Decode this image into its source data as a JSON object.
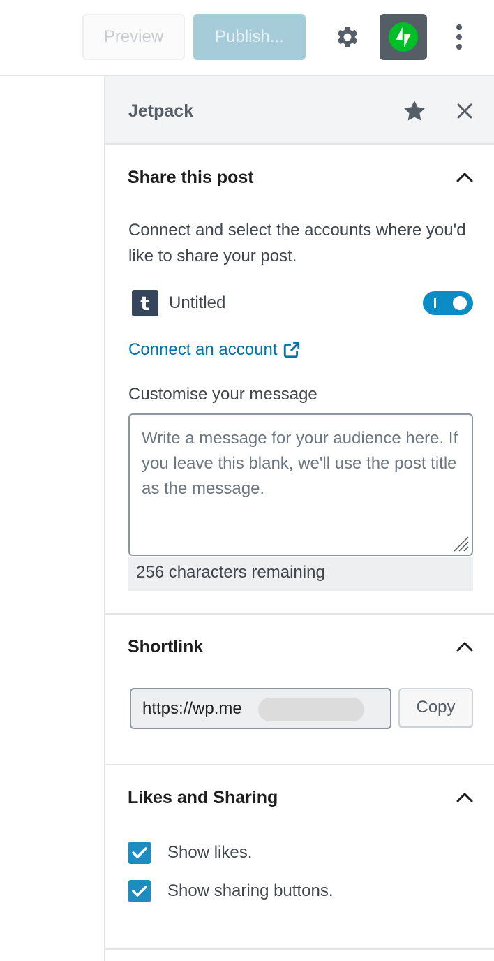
{
  "toolbar": {
    "preview_label": "Preview",
    "publish_label": "Publish...",
    "settings_icon": "gear-icon",
    "jetpack_icon": "jetpack-bolt-icon",
    "more_icon": "vertical-ellipsis-icon",
    "jetpack_color": "#00be28"
  },
  "sidebar": {
    "title": "Jetpack",
    "share": {
      "title": "Share this post",
      "description": "Connect and select the accounts where you'd like to share your post.",
      "account": {
        "service_icon": "tumblr-icon",
        "icon_letter": "t",
        "name": "Untitled",
        "enabled": true
      },
      "connect_label": "Connect an account",
      "message_label": "Customise your message",
      "message_placeholder": "Write a message for your audience here. If you leave this blank, we'll use the post title as the message.",
      "counter": "256 characters remaining"
    },
    "shortlink": {
      "title": "Shortlink",
      "value": "https://wp.me",
      "copy_label": "Copy"
    },
    "likes": {
      "title": "Likes and Sharing",
      "options": [
        {
          "label": "Show likes.",
          "checked": true
        },
        {
          "label": "Show sharing buttons.",
          "checked": true
        }
      ]
    }
  },
  "colors": {
    "accent": "#0073aa",
    "toggle_on": "#0a8cc6",
    "checkbox": "#1e8cbe"
  }
}
